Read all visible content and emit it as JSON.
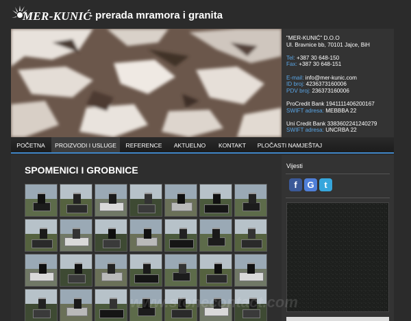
{
  "header": {
    "logo_text": "MER-KUNIĆ",
    "tagline": "- prerada mramora i granita"
  },
  "contact": {
    "company": "\"MER-KUNIĆ\" D.O.O",
    "address": "Ul. Bravnice bb, 70101 Jajce, BiH",
    "tel_label": "Tel:",
    "tel": "+387 30 648-150",
    "fax_label": "Fax:",
    "fax": "+387 30 648-151",
    "email_label": "E-mail:",
    "email": "info@mer-kunic.com",
    "id_label": "ID broj:",
    "id": "4236373160006",
    "pdv_label": "PDV broj:",
    "pdv": "236373160006",
    "bank1": "ProCredit Bank 1941111406200167",
    "swift1_label": "SWIFT adresa:",
    "swift1": "MEBBBA 22",
    "bank2": "Uni Credit Bank 3383602241240279",
    "swift2_label": "SWIFT adresa:",
    "swift2": "UNCRBA 22"
  },
  "nav": {
    "items": [
      {
        "label": "POČETNA"
      },
      {
        "label": "PROIZVODI I USLUGE"
      },
      {
        "label": "REFERENCE"
      },
      {
        "label": "AKTUELNO"
      },
      {
        "label": "KONTAKT"
      },
      {
        "label": "PLOČASTI NAMJEŠTAJ"
      }
    ],
    "active_index": 1,
    "accent": "#3f86c8"
  },
  "main": {
    "title": "SPOMENICI I GROBNICE",
    "gallery_icon": "monument-photo-thumbnail"
  },
  "sidebar": {
    "title": "Vijesti",
    "social": [
      {
        "icon": "facebook-icon",
        "glyph": "f",
        "color": "#3b5998"
      },
      {
        "icon": "google-icon",
        "glyph": "G",
        "color": "#4f7fd8"
      },
      {
        "icon": "twitter-icon",
        "glyph": "t",
        "color": "#36a6dc"
      }
    ]
  },
  "watermark": "www.stonecontact.com"
}
